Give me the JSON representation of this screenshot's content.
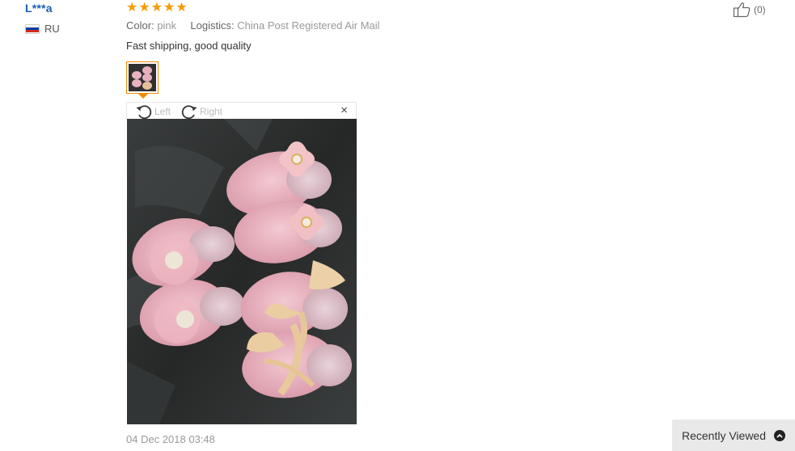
{
  "review": {
    "user": "L***a",
    "country": "RU",
    "rating": 5,
    "color_label": "Color:",
    "color_value": "pink",
    "logistics_label": "Logistics:",
    "logistics_value": "China Post Registered Air Mail",
    "text": "Fast shipping, good quality",
    "date": "04 Dec 2018 03:48",
    "helpful_count": "(0)"
  },
  "viewer": {
    "rotate_left_label": "Left",
    "rotate_right_label": "Right",
    "close_symbol": "×"
  },
  "recently_viewed": {
    "label": "Recently Viewed"
  },
  "icons": {
    "star": "star-icon",
    "thumbs_up": "thumbs-up-icon",
    "rotate_left": "rotate-left-icon",
    "rotate_right": "rotate-right-icon",
    "close": "close-icon",
    "chevron_up": "chevron-up-icon"
  },
  "colors": {
    "star": "#f59b00",
    "username": "#1a5fb4",
    "thumb_border": "#f08a00"
  }
}
